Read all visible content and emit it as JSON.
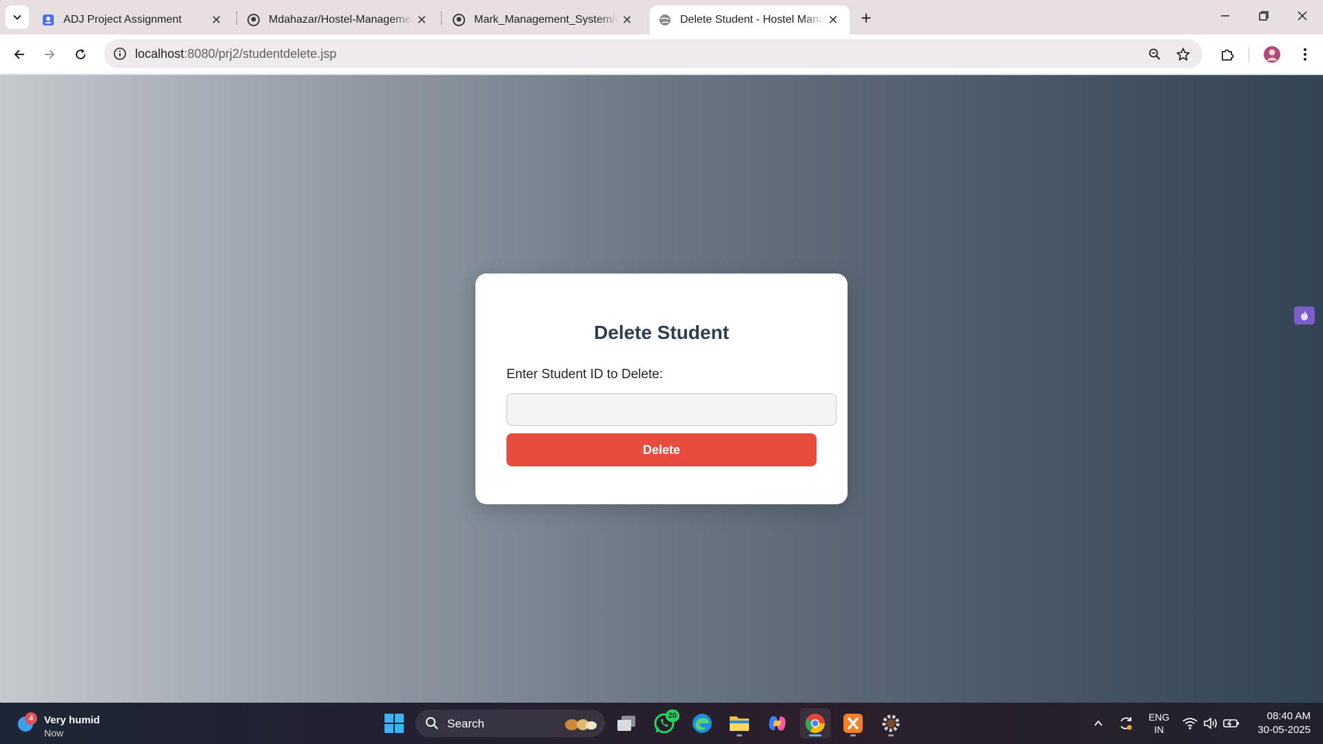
{
  "browser": {
    "tabs": [
      {
        "title": "ADJ Project Assignment",
        "favicon": "form-icon",
        "active": false
      },
      {
        "title": "Mdahazar/Hostel-Management",
        "favicon": "github-icon",
        "active": false
      },
      {
        "title": "Mark_Management_System/out",
        "favicon": "github-icon",
        "active": false
      },
      {
        "title": "Delete Student - Hostel Manage",
        "favicon": "globe-icon",
        "active": true
      }
    ],
    "address": {
      "host": "localhost",
      "path": ":8080/prj2/studentdelete.jsp"
    }
  },
  "page": {
    "heading": "Delete Student",
    "field_label": "Enter Student ID to Delete:",
    "field_value": "",
    "button_label": "Delete",
    "button_color": "#e74c3c",
    "heading_color": "#2c3e50"
  },
  "taskbar": {
    "weather_text": "Very humid",
    "weather_time": "Now",
    "weather_badge": "4",
    "search_label": "Search",
    "whatsapp_badge": "20",
    "lang_line1": "ENG",
    "lang_line2": "IN",
    "time": "08:40 AM",
    "date": "30-05-2025"
  }
}
